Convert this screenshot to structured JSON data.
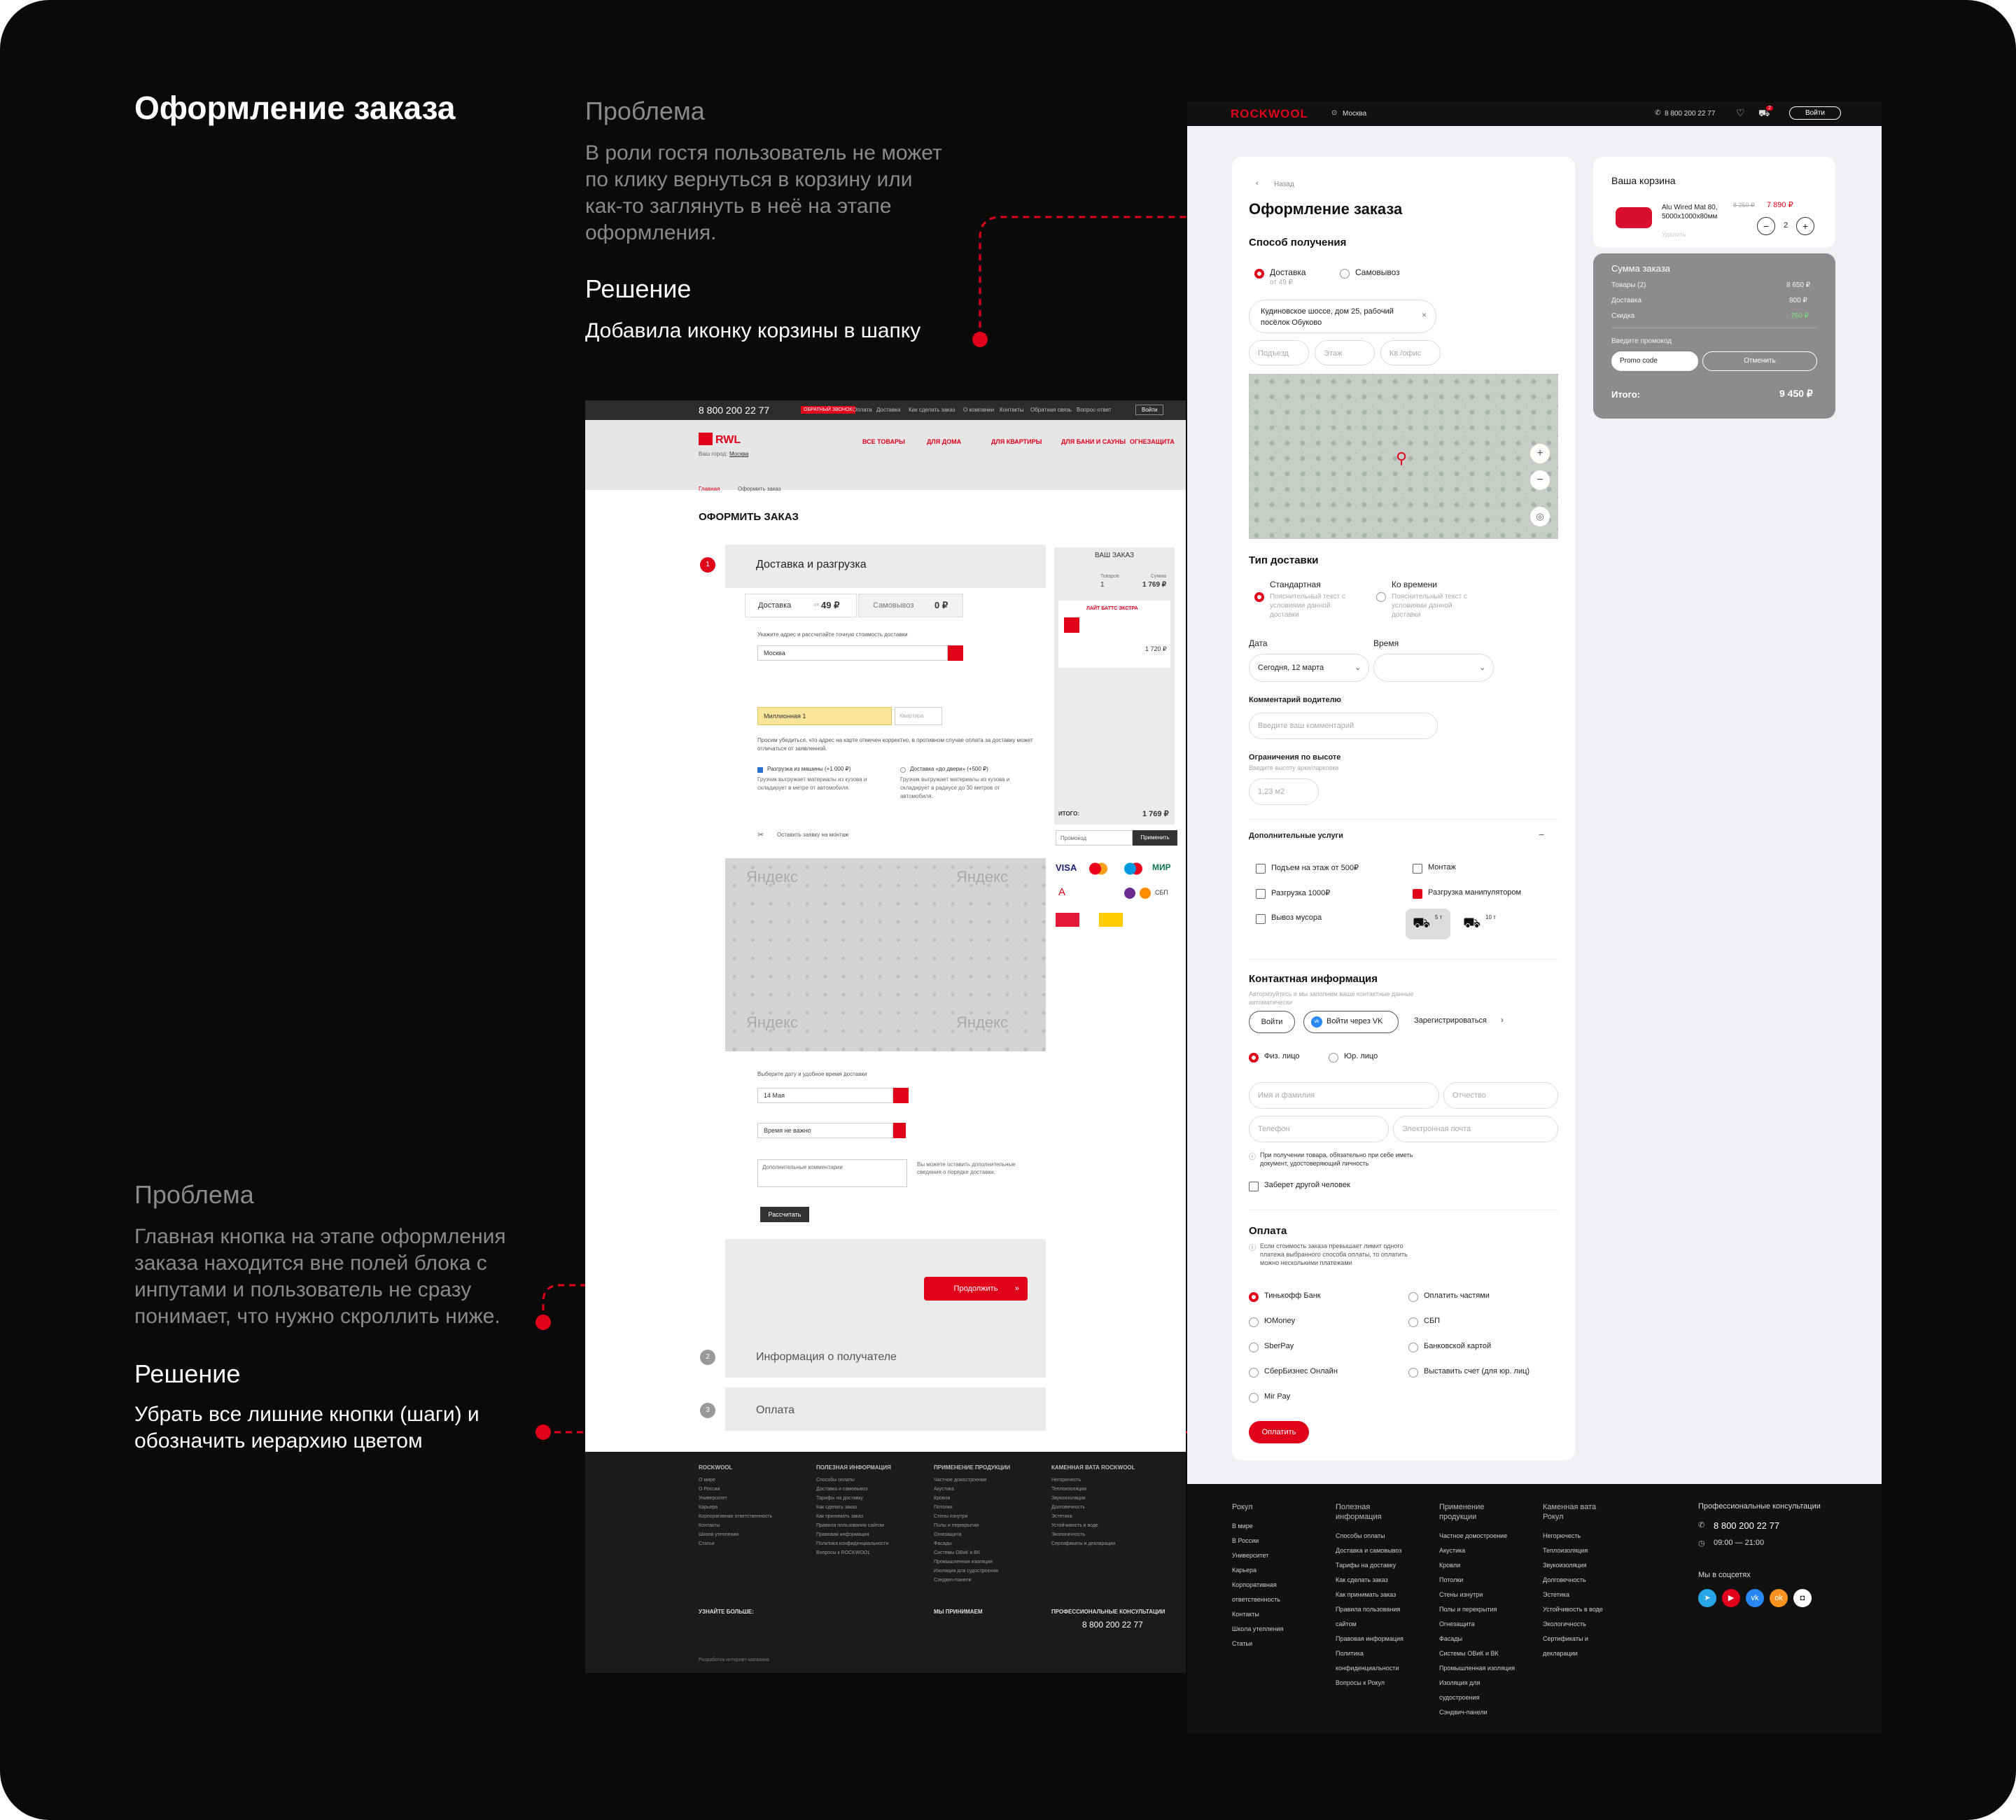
{
  "captions": {
    "title": "Оформление заказа",
    "problem1_heading": "Проблема",
    "problem1_text": "В роли гостя пользователь не может по клику вернуться в корзину или как-то заглянуть в неё на этапе оформления.",
    "solution1_heading": "Решение",
    "solution1_text": "Добавила иконку корзины в шапку",
    "problem2_heading": "Проблема",
    "problem2_text": "Главная кнопка на этапе оформления заказа находится вне полей блока с инпутами и пользователь не сразу понимает, что нужно скроллить ниже.",
    "solution2_heading": "Решение",
    "solution2_text": "Убрать все лишние кнопки (шаги) и обозначить иерархию цветом"
  },
  "accent_color": "#e0001a",
  "old_page": {
    "phone": "8 800 200 22 77",
    "callback": "ОБРАТНЫЙ ЗВОНОК",
    "top_links": [
      "Оплата",
      "Доставка",
      "Как сделать заказ",
      "О компании",
      "Контакты",
      "Обратная связь",
      "Вопрос-ответ"
    ],
    "login": "Войти",
    "logo": "RWL",
    "city_label": "Ваш город:",
    "city": "Москва",
    "nav": [
      "ВСЕ ТОВАРЫ",
      "ДЛЯ ДОМА",
      "ДЛЯ КВАРТИРЫ",
      "ДЛЯ БАНИ И САУНЫ",
      "ОГНЕЗАЩИТА"
    ],
    "breadcrumb": [
      "Главная",
      "Оформить заказ"
    ],
    "page_title": "ОФОРМИТЬ ЗАКАЗ",
    "step1_num": "1",
    "step1_title": "Доставка и разгрузка",
    "tab_delivery": "Доставка",
    "tab_delivery_from": "от",
    "tab_delivery_price": "49 ₽",
    "tab_pickup": "Самовывоз",
    "tab_pickup_price": "0 ₽",
    "address_hint": "Укажите адрес и рассчитайте точную стоимость доставки",
    "city_select": "Москва",
    "street_value": "Миллионная 1",
    "apartment": "Квартира",
    "check_hint": "Просим убедиться, что адрес на карте отмечен корректно, в противном случае оплата за доставку может отличаться от заявленной.",
    "unload_car": "Разгрузка из машины (+1 000 ₽)",
    "unload_car_desc": "Грузчик выгружает материалы из кузова и складирует в метре от автомобиля.",
    "door_delivery": "Доставка «до двери» (+500 ₽)",
    "door_delivery_desc": "Грузчик выгружает материалы из кузова и складирует в радиусе до 30 метров от автомобиля.",
    "install_link": "Оставить заявку на монтаж",
    "map_brand": "Яндекс",
    "date_hint": "Выберите дату и удобное время доставки",
    "date_value": "14 Мая",
    "time_value": "Время не важно",
    "comment_placeholder": "Дополнительные комментарии",
    "comment_note": "Вы можете оставить дополнительные сведения о порядке доставки.",
    "calc_button": "Рассчитать",
    "continue_button": "Продолжить",
    "continue_arrow": "»",
    "step2_num": "2",
    "step2_title": "Информация о получателе",
    "step3_num": "3",
    "step3_title": "Оплата",
    "order_title": "ВАШ ЗАКАЗ",
    "order_goods_label": "Товаров",
    "order_goods": "1",
    "order_sum_label": "Сумма",
    "order_sum": "1 769 ₽",
    "order_item": "ЛАЙТ БАТТС ЭКСТРА",
    "order_item_price": "1 720 ₽",
    "order_total_label": "ИТОГО:",
    "order_total": "1 769 ₽",
    "promo_placeholder": "Промокод",
    "promo_apply": "Применить",
    "payments": [
      "VISA",
      "MC",
      "Maestro",
      "МИР",
      "А",
      "ПСБ",
      "Сбер",
      "ЮMoney",
      "Qiwi",
      "СБП",
      "UnionPay",
      "Norton"
    ],
    "footer_cols": [
      {
        "title": "ROCKWOOL",
        "items": [
          "О мире",
          "О России",
          "Университет",
          "Карьера",
          "Корпоративная ответственность",
          "Контакты",
          "Школа утепления",
          "Статьи"
        ]
      },
      {
        "title": "ПОЛЕЗНАЯ ИНФОРМАЦИЯ",
        "items": [
          "Способы оплаты",
          "Доставка и самовывоз",
          "Тарифы на доставку",
          "Как сделать заказ",
          "Как принимать заказ",
          "Правила пользования сайтом",
          "Правовая информация",
          "Политика конфиденциальности",
          "Вопросы к ROCKWOOL"
        ]
      },
      {
        "title": "ПРИМЕНЕНИЕ ПРОДУКЦИИ",
        "items": [
          "Частное домостроение",
          "Акустика",
          "Кровли",
          "Потолки",
          "Стены изнутри",
          "Полы и перекрытия",
          "Огнезащита",
          "Фасады",
          "Системы ОВиК и ВК",
          "Промышленная изоляция",
          "Изоляция для судостроения",
          "Сэндвич-панели"
        ]
      },
      {
        "title": "КАМЕННАЯ ВАТА ROCKWOOL",
        "items": [
          "Негорючесть",
          "Теплоизоляция",
          "Звукоизоляция",
          "Долговечность",
          "Эстетика",
          "Устойчивость в воде",
          "Экологичность",
          "Сертификаты и декларации"
        ]
      }
    ],
    "social_label": "УЗНАЙТЕ БОЛЬШЕ:",
    "we_accept": "МЫ ПРИНИМАЕМ",
    "consult_label": "ПРОФЕССИОНАЛЬНЫЕ КОНСУЛЬТАЦИИ",
    "consult_phone": "8 800 200 22 77",
    "developer": "Разработка интернет-магазина"
  },
  "new_page": {
    "logo": "ROCKWOOL",
    "city": "Москва",
    "phone": "8 800 200 22 77",
    "cart_count": "2",
    "login": "Войти",
    "back": "Назад",
    "title": "Оформление заказа",
    "receive_title": "Способ получения",
    "delivery": "Доставка",
    "delivery_price": "от 49 ₽",
    "pickup": "Самовывоз",
    "address": "Кудиновское шоссе, дом 25, рабочий посёлок Обуково",
    "entrance": "Подъезд",
    "floor": "Этаж",
    "apartment": "Кв./офис",
    "delivery_type_title": "Тип доставки",
    "standard": "Стандартная",
    "standard_desc": "Пояснительный текст с условиями данной доставки",
    "by_time": "Ко времени",
    "by_time_desc": "Пояснительный текст с условиями данной доставки",
    "date_label": "Дата",
    "date_value": "Сегодня, 12 марта",
    "time_label": "Время",
    "comment_label": "Комментарий водителю",
    "comment_placeholder": "Введите ваш комментарий",
    "height_label": "Ограничения по высоте",
    "height_hint": "Введите высоту арки/парковки",
    "height_value": "1,23 м2",
    "extra_title": "Дополнительные услуги",
    "services": [
      "Подъем на этаж от 500₽",
      "Монтаж",
      "Разгрузка 1000₽",
      "Разгрузка манипулятором",
      "Вывоз мусора"
    ],
    "truck1": "5 т",
    "truck2": "10 т",
    "contacts_title": "Контактная информация",
    "contacts_hint": "Авторизуйтесь и мы заполним ваши контактные данные автоматически",
    "login_btn": "Войти",
    "vk_btn": "Войти через VK",
    "register": "Зарегистрироваться",
    "person": "Физ. лицо",
    "company": "Юр. лицо",
    "name_ph": "Имя и фамилия",
    "patronymic_ph": "Отчество",
    "phone_ph": "Телефон",
    "email_ph": "Электронная почта",
    "id_note": "При получении товара, обязательно при себе иметь документ, удостоверяющий личность",
    "other_person": "Заберет другой человек",
    "payment_title": "Оплата",
    "payment_note": "Если стоимость заказа превышает лимит одного платежа выбранного способа оплаты, то оплатить можно несколькими платежами",
    "payments_left": [
      "Тинькофф Банк",
      "ЮMoney",
      "SberPay",
      "СберБизнес Онлайн",
      "Mir Pay"
    ],
    "payments_right": [
      "Оплатить частями",
      "СБП",
      "Банковской картой",
      "Выставить счет (для юр. лиц)"
    ],
    "pay_button": "Оплатить",
    "cart_title": "Ваша корзина",
    "cart_item": "Alu Wired Mat 80, 5000х1000х80мм",
    "cart_old_price": "8 250 ₽",
    "cart_price": "7 890 ₽",
    "cart_qty": "2",
    "cart_delete": "Удалить",
    "summary_title": "Сумма заказа",
    "summary_goods": "Товары (2)",
    "summary_goods_val": "8 650 ₽",
    "summary_delivery": "Доставка",
    "summary_delivery_val": "800 ₽",
    "summary_discount": "Скидка",
    "summary_discount_val": "- 760 ₽",
    "promo_label": "Введите промокод",
    "promo_value": "Promo code",
    "promo_cancel": "Отменить",
    "total_label": "Итого:",
    "total_val": "9 450 ₽",
    "footer_cols": [
      {
        "title": "Рокул",
        "items": [
          "В мире",
          "В России",
          "Университет",
          "Карьера",
          "Корпоративная ответственность",
          "Контакты",
          "Школа утепления",
          "Статьи"
        ]
      },
      {
        "title": "Полезная информация",
        "items": [
          "Способы оплаты",
          "Доставка и самовывоз",
          "Тарифы на доставку",
          "Как сделать заказ",
          "Как принимать заказ",
          "Правила пользования сайтом",
          "Правовая информация",
          "Политика конфиденциальности",
          "Вопросы к Рокул"
        ]
      },
      {
        "title": "Применение продукции",
        "items": [
          "Частное домостроение",
          "Акустика",
          "Кровли",
          "Потолки",
          "Стены изнутри",
          "Полы и перекрытия",
          "Огнезащита",
          "Фасады",
          "Системы ОВиК и ВК",
          "Промышленная изоляция",
          "Изоляция для судостроения",
          "Сэндвич-панели"
        ]
      },
      {
        "title": "Каменная вата Рокул",
        "items": [
          "Негорючесть",
          "Теплоизоляция",
          "Звукоизоляция",
          "Долговечность",
          "Эстетика",
          "Устойчивость в воде",
          "Экологичность",
          "Сертификаты и декларации"
        ]
      }
    ],
    "consult_title": "Профессиональные консультации",
    "consult_phone": "8 800 200 22 77",
    "consult_hours": "09:00 — 21:00",
    "socials_title": "Мы в соцсетях"
  }
}
